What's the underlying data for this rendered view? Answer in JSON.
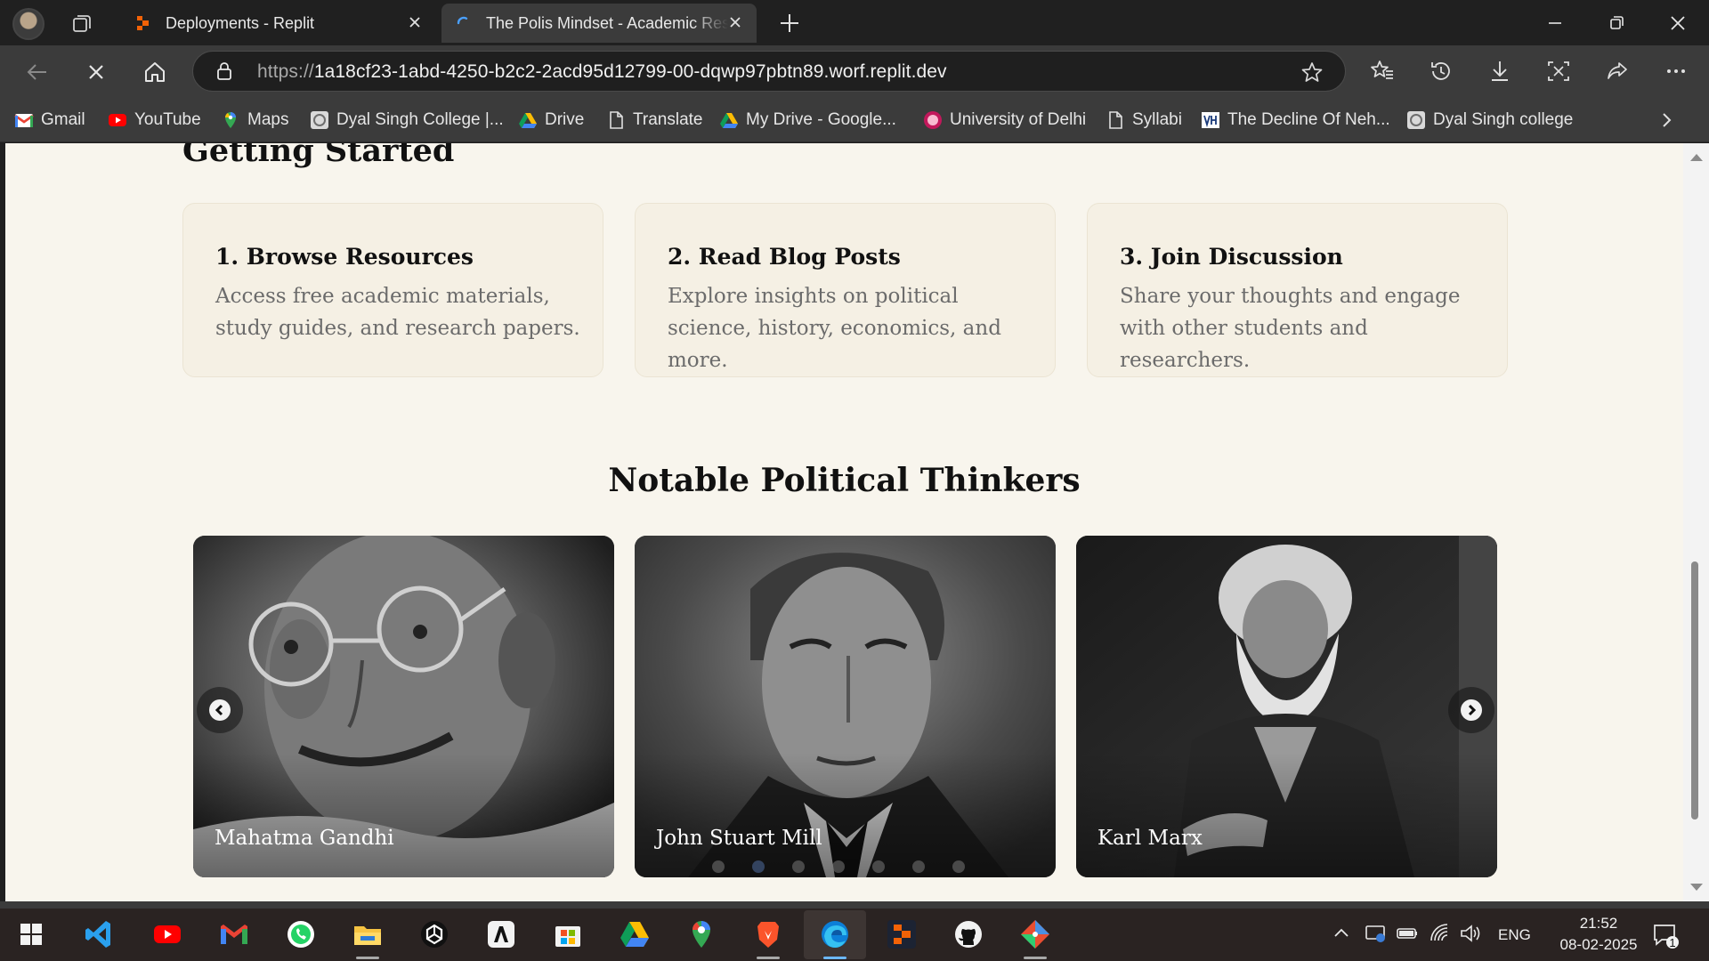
{
  "browser": {
    "tabs": [
      {
        "title": "Deployments - Replit",
        "active": false,
        "icon": "replit-icon"
      },
      {
        "title": "The Polis Mindset - Academic Res",
        "active": true,
        "icon": "loading-spinner-icon"
      }
    ],
    "url": {
      "scheme": "https://",
      "host": "1a18cf23-1abd-4250-b2c2-2acd95d12799-00-dqwp97pbtn89.worf.replit.dev"
    },
    "favorites": [
      {
        "label": "Gmail",
        "icon": "gmail-icon"
      },
      {
        "label": "YouTube",
        "icon": "youtube-icon"
      },
      {
        "label": "Maps",
        "icon": "maps-icon"
      },
      {
        "label": "Dyal Singh College |...",
        "icon": "college-icon"
      },
      {
        "label": "Drive",
        "icon": "drive-icon"
      },
      {
        "label": "Translate",
        "icon": "page-icon"
      },
      {
        "label": "My Drive - Google...",
        "icon": "drive-icon"
      },
      {
        "label": "University of Delhi",
        "icon": "university-icon"
      },
      {
        "label": "Syllabi",
        "icon": "page-icon"
      },
      {
        "label": "The Decline Of Neh...",
        "icon": "article-icon"
      },
      {
        "label": "Dyal Singh college",
        "icon": "college-icon"
      }
    ]
  },
  "page": {
    "getting_started_title": "Getting Started",
    "steps": [
      {
        "title": "1. Browse Resources",
        "text": "Access free academic materials, study guides, and research papers."
      },
      {
        "title": "2. Read Blog Posts",
        "text": "Explore insights on political science, history, economics, and more."
      },
      {
        "title": "3. Join Discussion",
        "text": "Share your thoughts and engage with other students and researchers."
      }
    ],
    "thinkers_title": "Notable Political Thinkers",
    "thinkers": [
      {
        "name": "Mahatma Gandhi"
      },
      {
        "name": "John Stuart Mill"
      },
      {
        "name": "Karl Marx"
      }
    ],
    "carousel": {
      "dot_count": 7,
      "active_dot": 1
    }
  },
  "taskbar": {
    "apps": [
      "windows-start-icon",
      "vscode-icon",
      "youtube-icon",
      "gmail-icon",
      "whatsapp-icon",
      "file-explorer-icon",
      "chatgpt-icon",
      "anthropic-icon",
      "microsoft-store-icon",
      "google-drive-icon",
      "google-maps-icon",
      "brave-icon",
      "edge-icon",
      "replit-icon",
      "github-icon",
      "git-icon"
    ],
    "language": "ENG",
    "time": "21:52",
    "date": "08-02-2025",
    "notifications": "1"
  },
  "colors": {
    "page_background": "#f8f5ed",
    "card_background": "#f5f0e4",
    "browser_chrome": "#3b3b3b",
    "tab_strip": "#202020",
    "taskbar": "#2a2322"
  }
}
